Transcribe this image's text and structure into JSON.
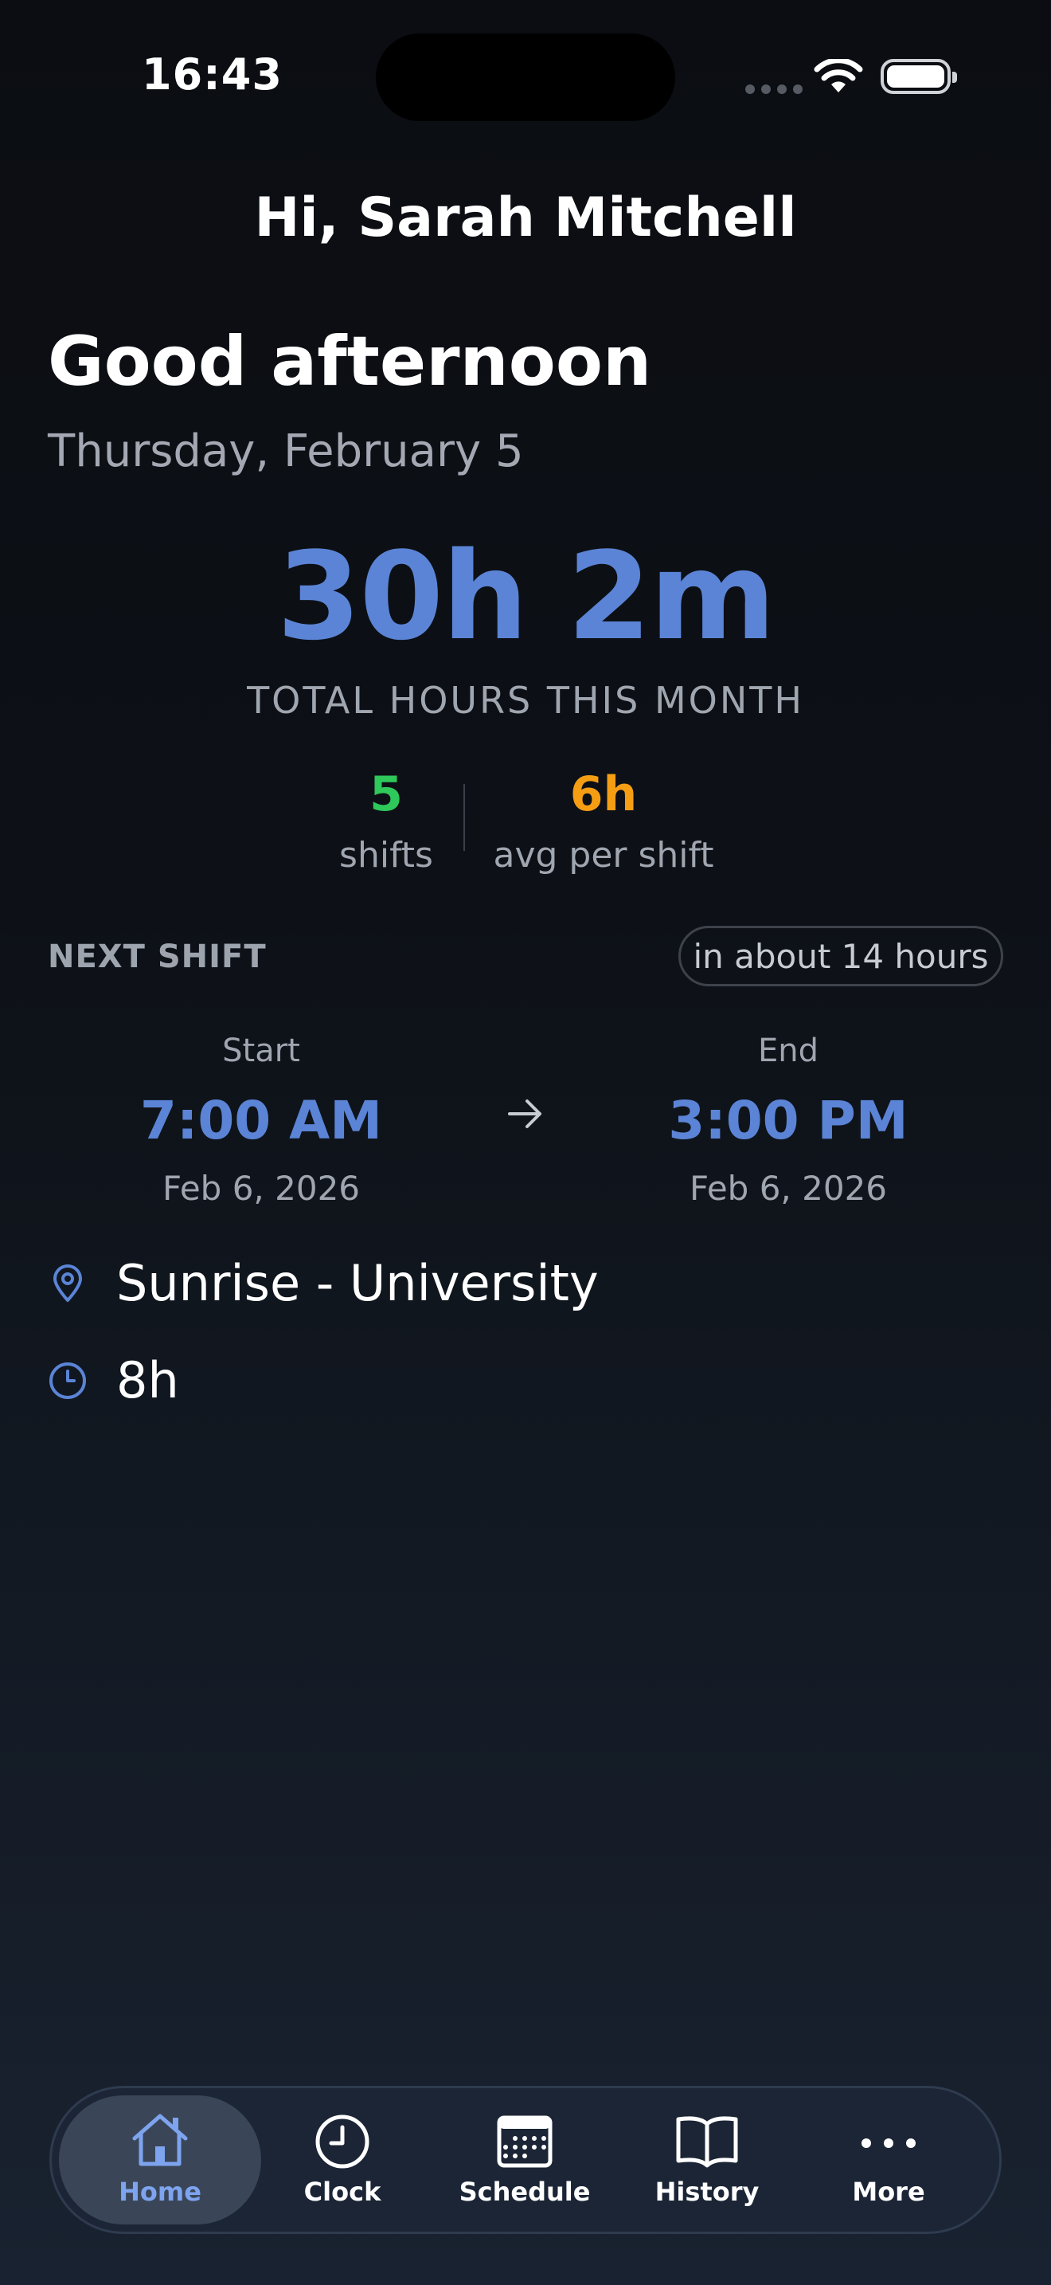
{
  "status_bar": {
    "time": "16:43"
  },
  "header": {
    "greeting": "Hi, Sarah Mitchell"
  },
  "hero": {
    "salutation": "Good afternoon",
    "date": "Thursday, February 5"
  },
  "summary": {
    "total_hours": "30h 2m",
    "total_label": "TOTAL HOURS THIS MONTH",
    "shifts_value": "5",
    "shifts_label": "shifts",
    "avg_value": "6h",
    "avg_label": "avg per shift"
  },
  "next_shift": {
    "label": "NEXT SHIFT",
    "countdown": "in about 14 hours",
    "start_caption": "Start",
    "start_time": "7:00 AM",
    "start_date": "Feb 6, 2026",
    "end_caption": "End",
    "end_time": "3:00 PM",
    "end_date": "Feb 6, 2026",
    "location": "Sunrise - University",
    "duration": "8h"
  },
  "tabs": [
    {
      "label": "Home",
      "icon": "home-icon",
      "active": true
    },
    {
      "label": "Clock",
      "icon": "clock-icon",
      "active": false
    },
    {
      "label": "Schedule",
      "icon": "calendar-icon",
      "active": false
    },
    {
      "label": "History",
      "icon": "book-icon",
      "active": false
    },
    {
      "label": "More",
      "icon": "more-icon",
      "active": false
    }
  ],
  "colors": {
    "accent": "#5b84d6",
    "active_tab": "#7ea4ef",
    "shifts": "#2fc85a",
    "avg": "#f59e14"
  }
}
